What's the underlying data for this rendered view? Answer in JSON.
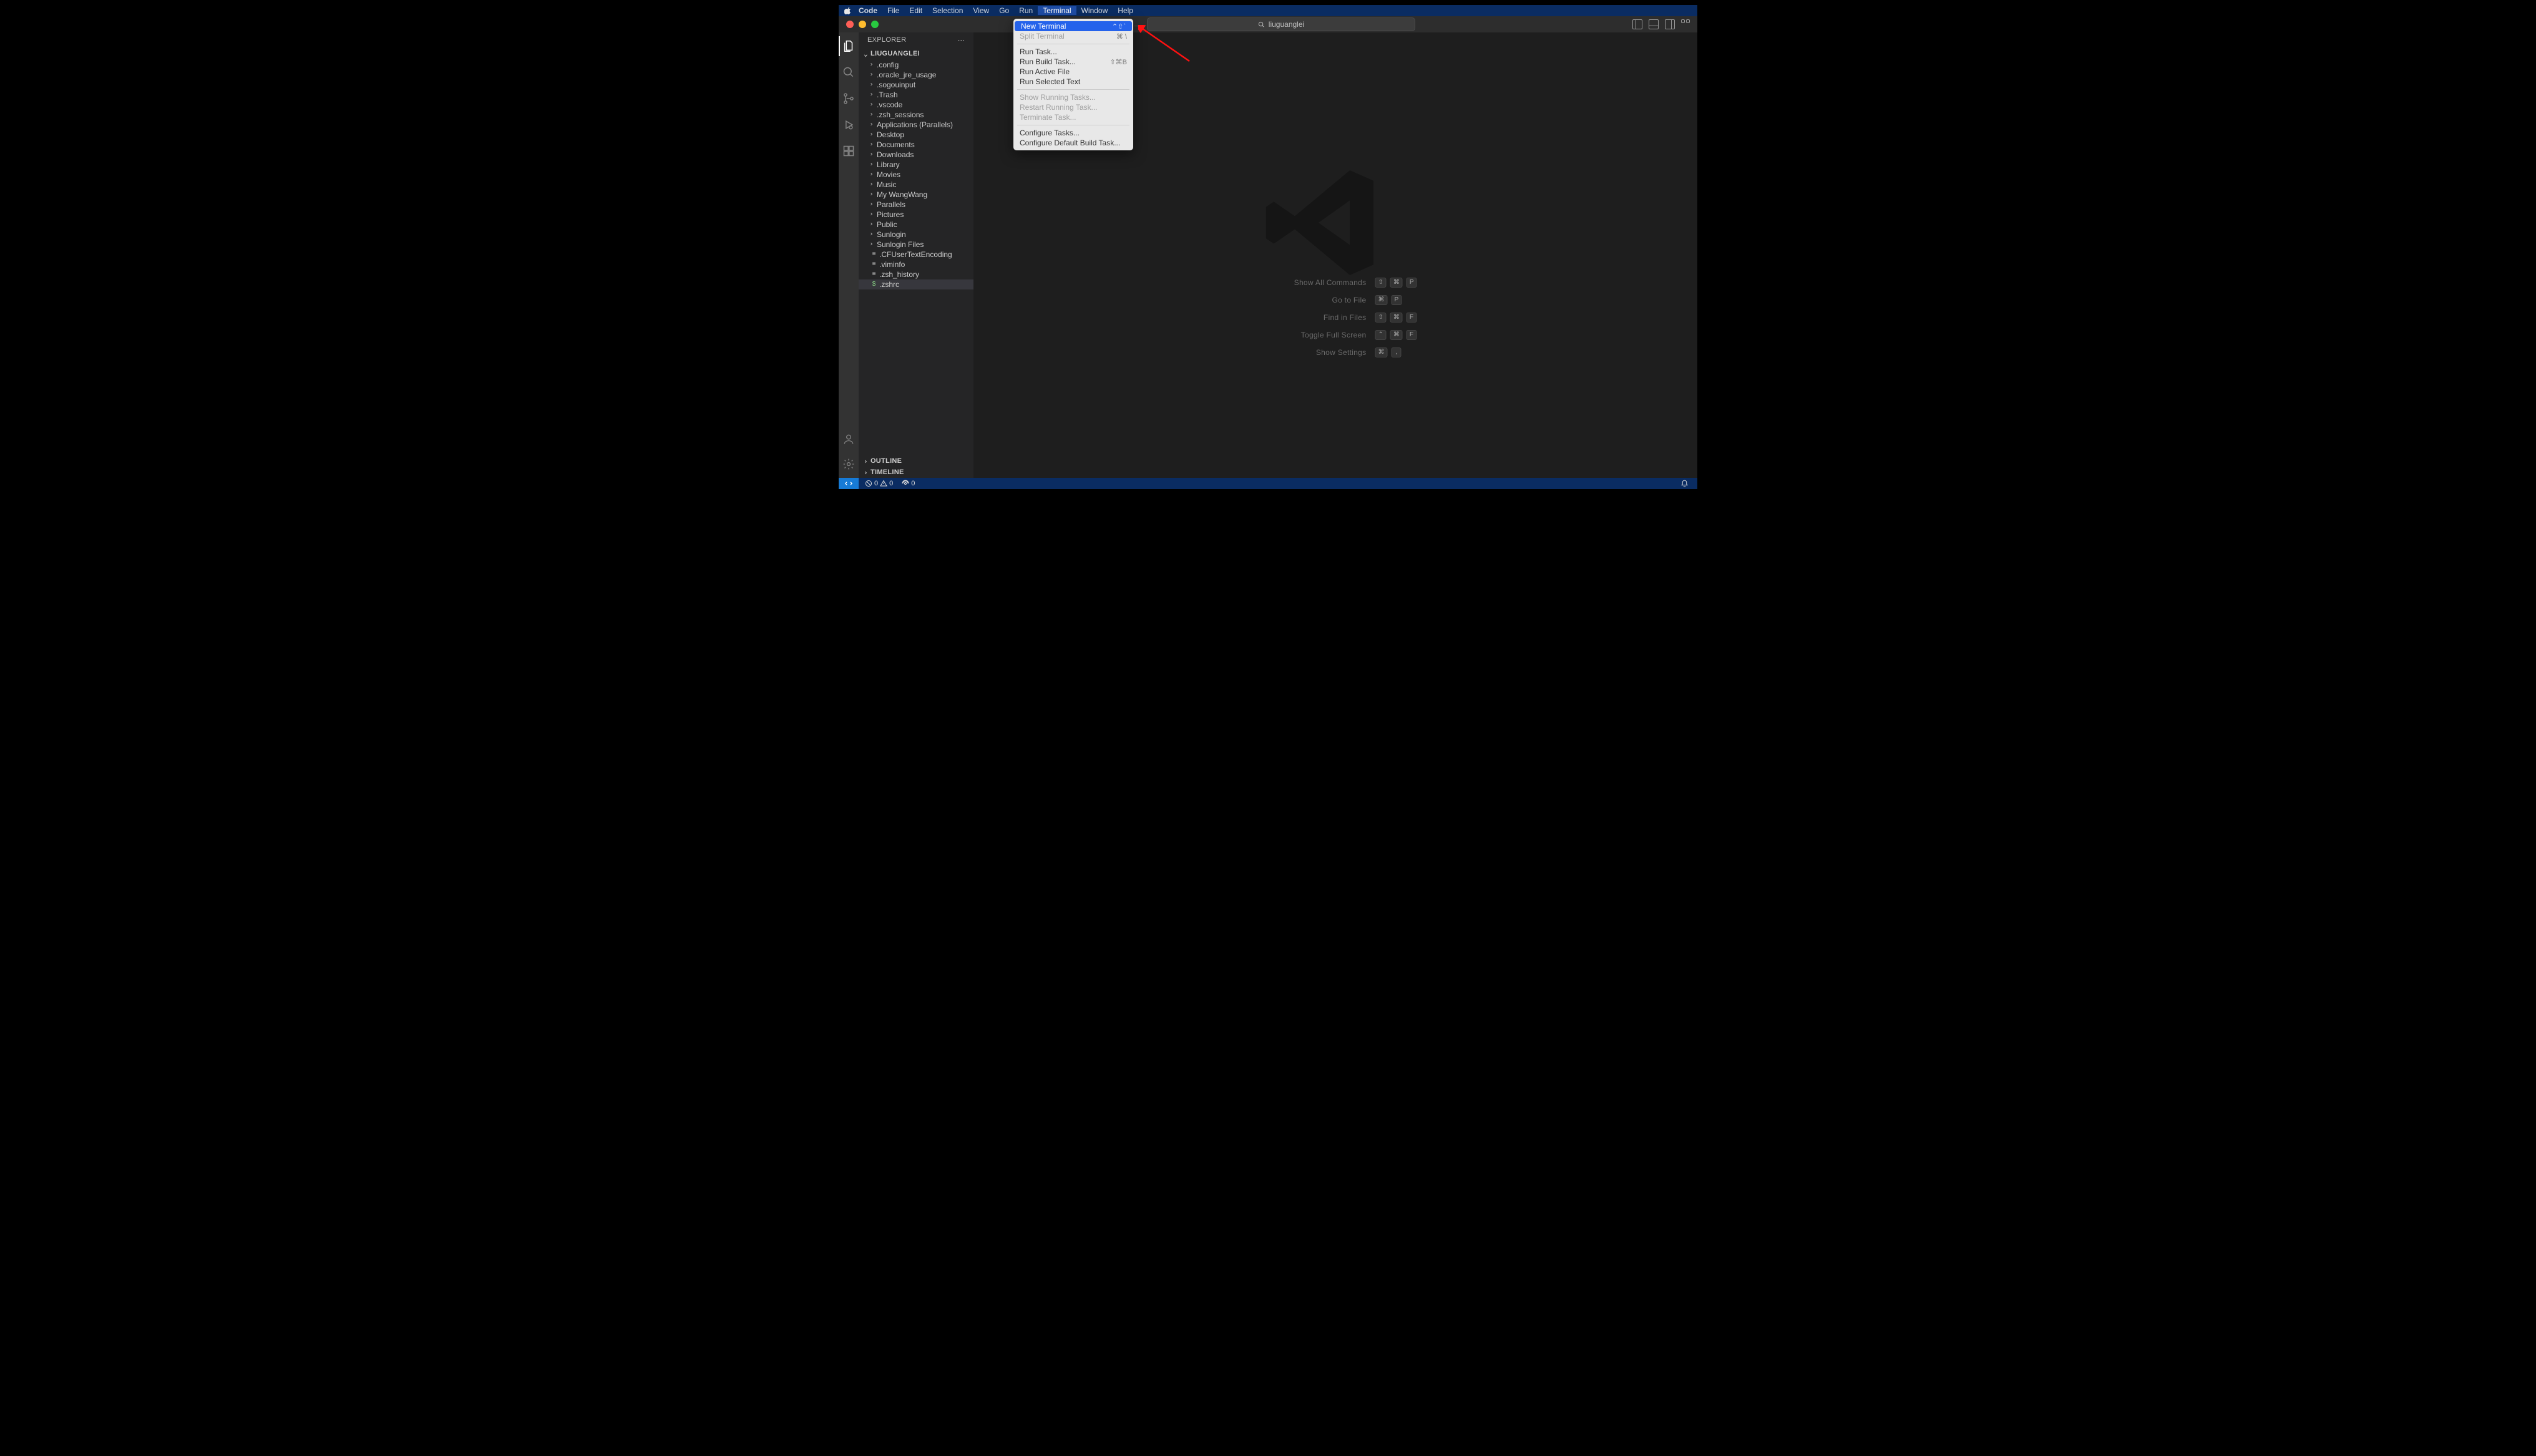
{
  "mac_menu": {
    "app": "Code",
    "items": [
      "File",
      "Edit",
      "Selection",
      "View",
      "Go",
      "Run",
      "Terminal",
      "Window",
      "Help"
    ],
    "active_index": 6
  },
  "titlebar": {
    "search_text": "liuguanglei"
  },
  "explorer": {
    "title": "EXPLORER",
    "root": "LIUGUANGLEI",
    "folders": [
      ".config",
      ".oracle_jre_usage",
      ".sogouinput",
      ".Trash",
      ".vscode",
      ".zsh_sessions",
      "Applications (Parallels)",
      "Desktop",
      "Documents",
      "Downloads",
      "Library",
      "Movies",
      "Music",
      "My WangWang",
      "Parallels",
      "Pictures",
      "Public",
      "Sunlogin",
      "Sunlogin Files"
    ],
    "files": [
      {
        "name": ".CFUserTextEncoding",
        "selected": false
      },
      {
        "name": ".viminfo",
        "selected": false
      },
      {
        "name": ".zsh_history",
        "selected": false
      },
      {
        "name": ".zshrc",
        "selected": true
      }
    ],
    "outline": "OUTLINE",
    "timeline": "TIMELINE"
  },
  "welcome": {
    "hints": [
      {
        "label": "Show All Commands",
        "keys": [
          "⇧",
          "⌘",
          "P"
        ]
      },
      {
        "label": "Go to File",
        "keys": [
          "⌘",
          "P"
        ]
      },
      {
        "label": "Find in Files",
        "keys": [
          "⇧",
          "⌘",
          "F"
        ]
      },
      {
        "label": "Toggle Full Screen",
        "keys": [
          "⌃",
          "⌘",
          "F"
        ]
      },
      {
        "label": "Show Settings",
        "keys": [
          "⌘",
          ","
        ]
      }
    ]
  },
  "statusbar": {
    "errors": "0",
    "warnings": "0",
    "ports": "0"
  },
  "dropdown": {
    "groups": [
      [
        {
          "label": "New Terminal",
          "shortcut": "⌃⇧`",
          "highlight": true,
          "disabled": false
        },
        {
          "label": "Split Terminal",
          "shortcut": "⌘ \\",
          "highlight": false,
          "disabled": true
        }
      ],
      [
        {
          "label": "Run Task...",
          "shortcut": "",
          "highlight": false,
          "disabled": false
        },
        {
          "label": "Run Build Task...",
          "shortcut": "⇧⌘B",
          "highlight": false,
          "disabled": false
        },
        {
          "label": "Run Active File",
          "shortcut": "",
          "highlight": false,
          "disabled": false
        },
        {
          "label": "Run Selected Text",
          "shortcut": "",
          "highlight": false,
          "disabled": false
        }
      ],
      [
        {
          "label": "Show Running Tasks...",
          "shortcut": "",
          "highlight": false,
          "disabled": true
        },
        {
          "label": "Restart Running Task...",
          "shortcut": "",
          "highlight": false,
          "disabled": true
        },
        {
          "label": "Terminate Task...",
          "shortcut": "",
          "highlight": false,
          "disabled": true
        }
      ],
      [
        {
          "label": "Configure Tasks...",
          "shortcut": "",
          "highlight": false,
          "disabled": false
        },
        {
          "label": "Configure Default Build Task...",
          "shortcut": "",
          "highlight": false,
          "disabled": false
        }
      ]
    ]
  }
}
